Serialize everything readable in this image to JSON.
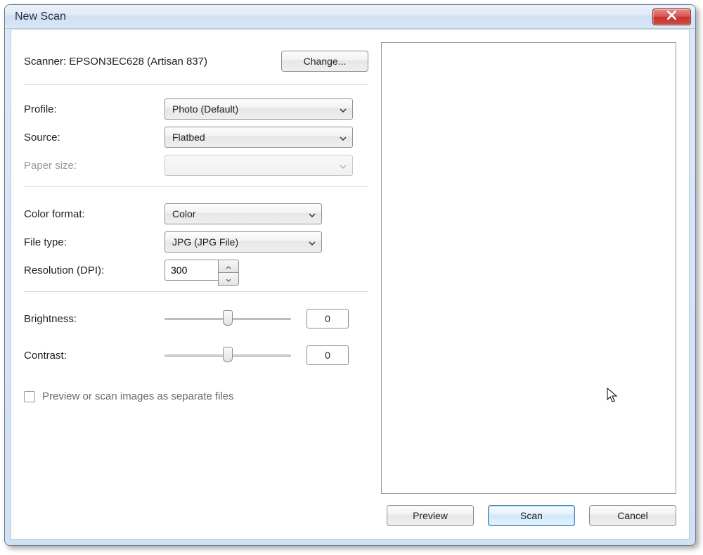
{
  "window": {
    "title": "New Scan"
  },
  "scanner": {
    "label_prefix": "Scanner: ",
    "name": "EPSON3EC628 (Artisan 837)",
    "change_btn": "Change..."
  },
  "fields": {
    "profile_label": "Profile:",
    "profile_value": "Photo (Default)",
    "source_label": "Source:",
    "source_value": "Flatbed",
    "papersize_label": "Paper size:",
    "papersize_value": "",
    "colorformat_label": "Color format:",
    "colorformat_value": "Color",
    "filetype_label": "File type:",
    "filetype_value": "JPG (JPG File)",
    "resolution_label": "Resolution (DPI):",
    "resolution_value": "300",
    "brightness_label": "Brightness:",
    "brightness_value": "0",
    "contrast_label": "Contrast:",
    "contrast_value": "0"
  },
  "checkbox": {
    "label": "Preview or scan images as separate files",
    "checked": false
  },
  "buttons": {
    "preview": "Preview",
    "scan": "Scan",
    "cancel": "Cancel"
  }
}
